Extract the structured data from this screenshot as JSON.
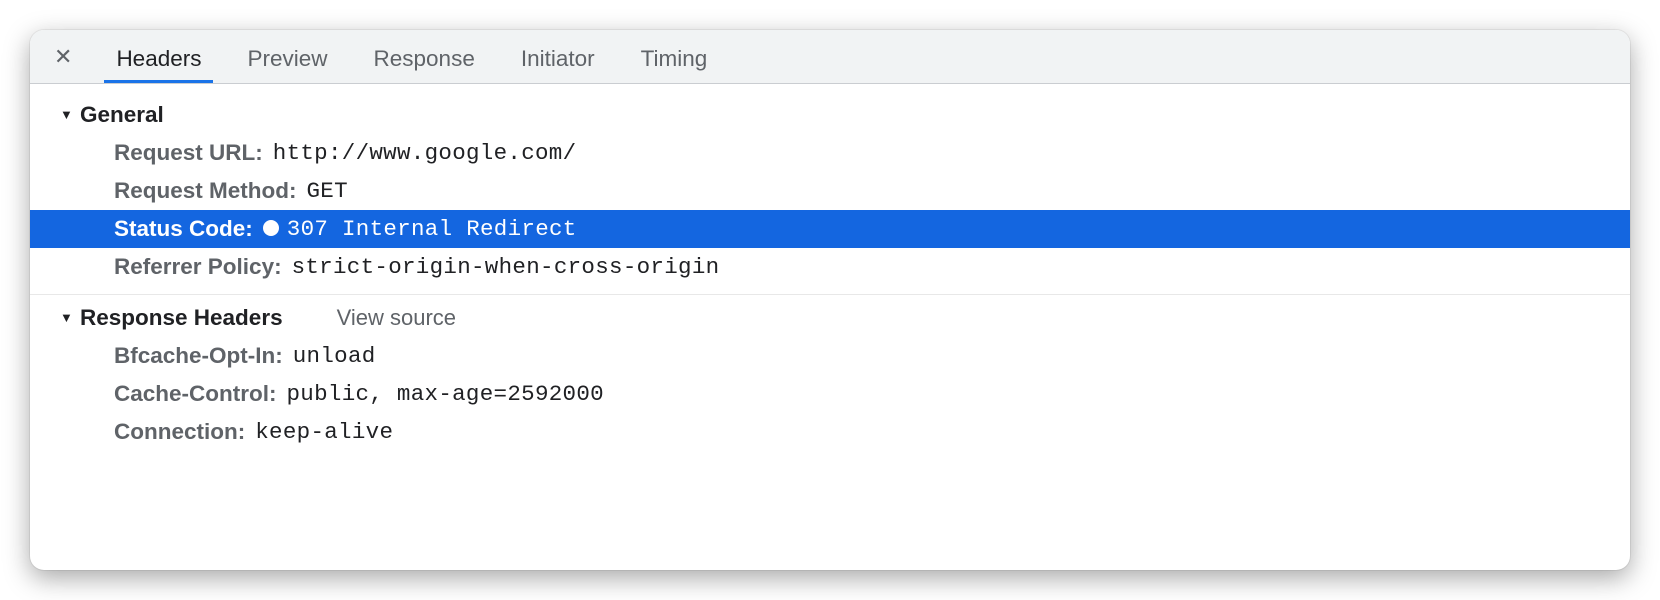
{
  "tabs": {
    "items": [
      {
        "label": "Headers",
        "active": true
      },
      {
        "label": "Preview",
        "active": false
      },
      {
        "label": "Response",
        "active": false
      },
      {
        "label": "Initiator",
        "active": false
      },
      {
        "label": "Timing",
        "active": false
      }
    ]
  },
  "sections": {
    "general": {
      "title": "General",
      "rows": {
        "request_url": {
          "label": "Request URL:",
          "value": "http://www.google.com/"
        },
        "request_method": {
          "label": "Request Method:",
          "value": "GET"
        },
        "status_code": {
          "label": "Status Code:",
          "value": "307 Internal Redirect",
          "selected": true
        },
        "referrer_policy": {
          "label": "Referrer Policy:",
          "value": "strict-origin-when-cross-origin"
        }
      }
    },
    "response_headers": {
      "title": "Response Headers",
      "view_source": "View source",
      "rows": {
        "bfcache_opt_in": {
          "label": "Bfcache-Opt-In:",
          "value": "unload"
        },
        "cache_control": {
          "label": "Cache-Control:",
          "value": "public, max-age=2592000"
        },
        "connection": {
          "label": "Connection:",
          "value": "keep-alive"
        }
      }
    }
  }
}
